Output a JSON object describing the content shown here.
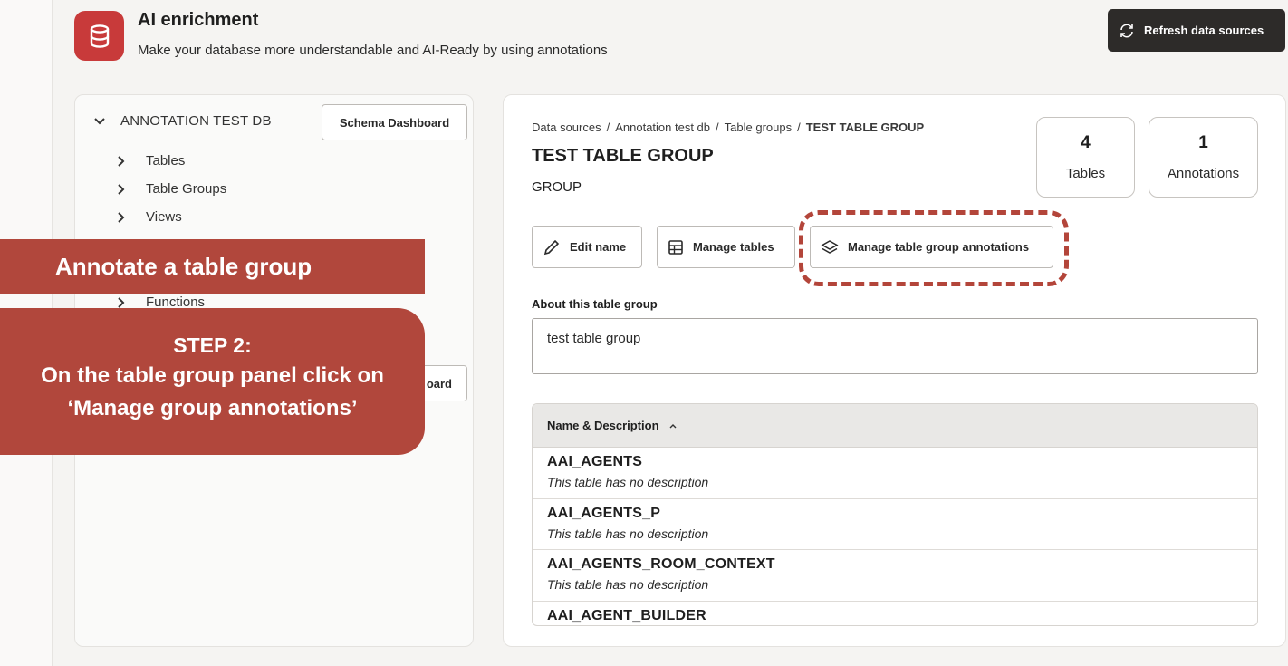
{
  "header": {
    "title": "AI enrichment",
    "subtitle": "Make your database more understandable and AI-Ready by using annotations",
    "refresh_label": "Refresh data sources"
  },
  "sidebar": {
    "db_name": "ANNOTATION TEST DB",
    "schema_dashboard_label": "Schema Dashboard",
    "schema_dashboard_partial": "oard",
    "items": [
      {
        "label": "Tables"
      },
      {
        "label": "Table Groups"
      },
      {
        "label": "Views"
      },
      {
        "label": "Functions"
      }
    ]
  },
  "main": {
    "breadcrumb": [
      "Data sources",
      "Annotation test db",
      "Table groups",
      "TEST TABLE GROUP"
    ],
    "title": "TEST TABLE GROUP",
    "subtitle": "GROUP",
    "stats": [
      {
        "value": "4",
        "label": "Tables"
      },
      {
        "value": "1",
        "label": "Annotations"
      }
    ],
    "actions": {
      "edit_name": "Edit name",
      "manage_tables": "Manage tables",
      "manage_annotations": "Manage table group annotations"
    },
    "about_label": "About this table group",
    "about_value": "test table group",
    "table": {
      "header": "Name & Description",
      "rows": [
        {
          "name": "AAI_AGENTS",
          "description": "This table has no description"
        },
        {
          "name": "AAI_AGENTS_P",
          "description": "This table has no description"
        },
        {
          "name": "AAI_AGENTS_ROOM_CONTEXT",
          "description": "This table has no description"
        },
        {
          "name": "AAI_AGENT_BUILDER",
          "description": ""
        }
      ]
    }
  },
  "overlay": {
    "banner": "Annotate a table group",
    "step_title": "STEP 2:",
    "step_line1": "On the table group panel click on",
    "step_line2": "‘Manage group annotations’"
  },
  "colors": {
    "accent": "#c83a3a",
    "overlay": "#b1473c",
    "dark_button": "#2d2b29"
  }
}
